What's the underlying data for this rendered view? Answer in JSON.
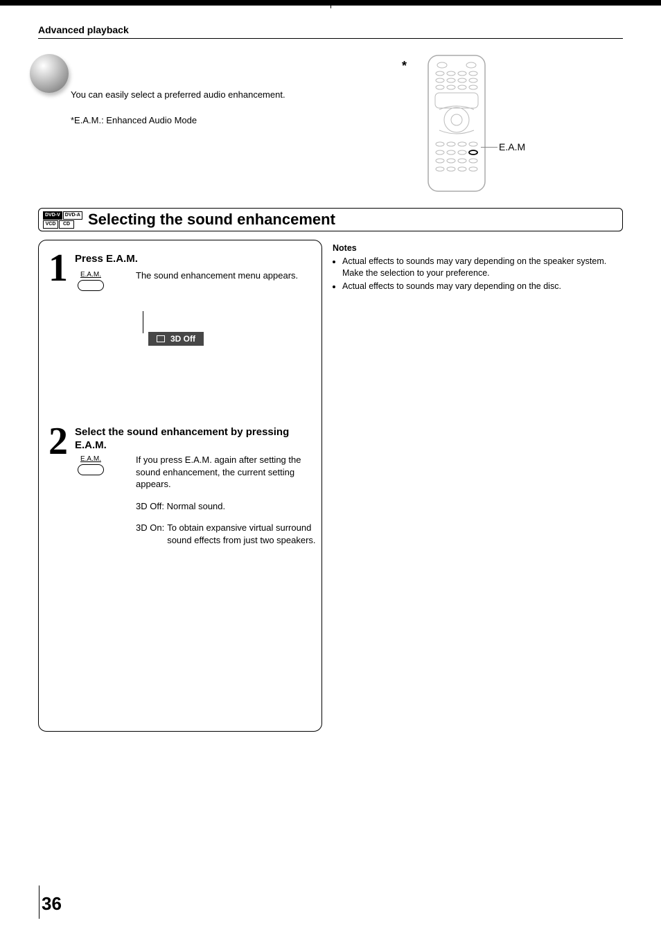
{
  "section": "Advanced playback",
  "intro": {
    "line1": "You can easily select a preferred audio enhancement.",
    "line2": "*E.A.M.: Enhanced Audio Mode"
  },
  "star": "*",
  "remote_callout": "E.A.M",
  "heading": {
    "badges": {
      "r1c1": "DVD-V",
      "r1c2": "DVD-A",
      "r2c1": "VCD",
      "r2c2": "CD"
    },
    "text": "Selecting the sound enhancement"
  },
  "steps": {
    "s1": {
      "num": "1",
      "head": "Press E.A.M.",
      "key_label": "E.A.M.",
      "body": "The sound enhancement menu appears.",
      "osd_text": "3D  Off"
    },
    "s2": {
      "num": "2",
      "head": "Select the sound enhancement by pressing E.A.M.",
      "key_label": "E.A.M.",
      "body": "If you press E.A.M. again after setting the sound enhancement, the current setting appears.",
      "def1_label": "3D Off:",
      "def1_text": "Normal sound.",
      "def2_label": "3D On:",
      "def2_text": "To obtain expansive virtual surround sound effects from just two speakers."
    }
  },
  "notes": {
    "title": "Notes",
    "items": [
      "Actual effects to sounds may vary depending on the speaker system.  Make the selection to your preference.",
      "Actual effects to sounds may vary depending on the disc."
    ]
  },
  "page_number": "36"
}
